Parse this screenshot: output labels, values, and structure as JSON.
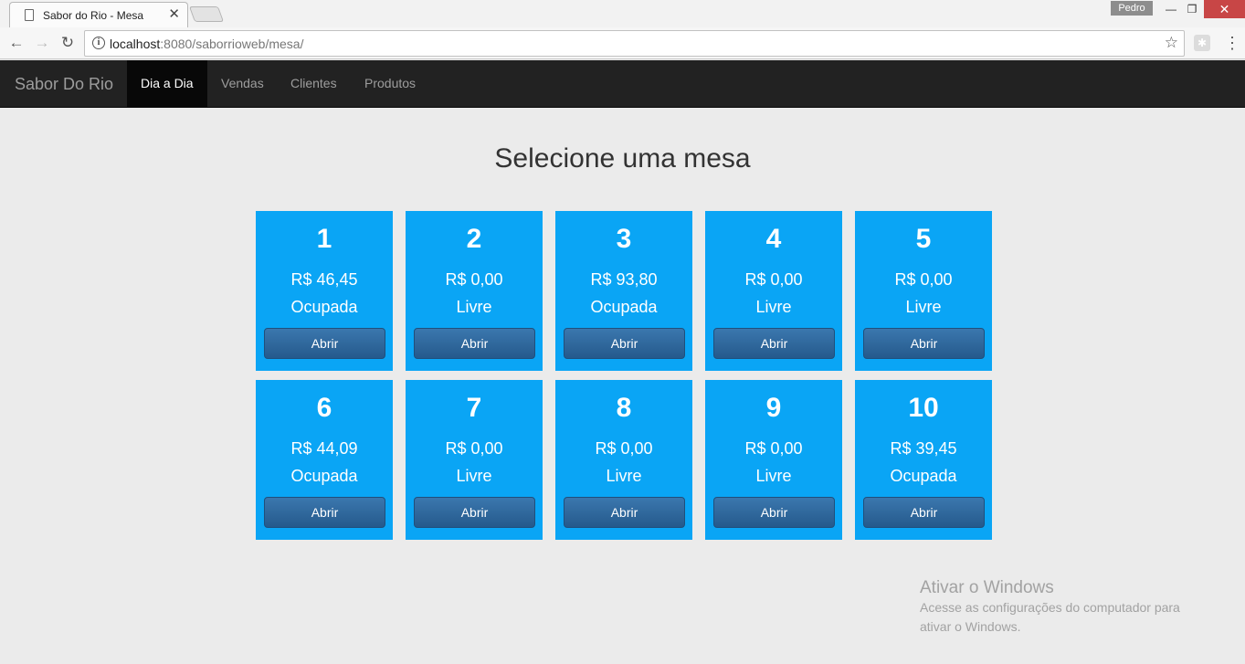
{
  "browser": {
    "tab_title": "Sabor do Rio - Mesa",
    "tab_close": "✕",
    "profile_name": "Pedro",
    "url_host": "localhost",
    "url_rest": ":8080/saborrioweb/mesa/"
  },
  "navbar": {
    "brand": "Sabor Do Rio",
    "items": [
      {
        "label": "Dia a Dia",
        "active": true
      },
      {
        "label": "Vendas",
        "active": false
      },
      {
        "label": "Clientes",
        "active": false
      },
      {
        "label": "Produtos",
        "active": false
      }
    ]
  },
  "page": {
    "title": "Selecione uma mesa"
  },
  "tables": [
    {
      "number": "1",
      "amount": "R$ 46,45",
      "status": "Ocupada",
      "button": "Abrir"
    },
    {
      "number": "2",
      "amount": "R$ 0,00",
      "status": "Livre",
      "button": "Abrir"
    },
    {
      "number": "3",
      "amount": "R$ 93,80",
      "status": "Ocupada",
      "button": "Abrir"
    },
    {
      "number": "4",
      "amount": "R$ 0,00",
      "status": "Livre",
      "button": "Abrir"
    },
    {
      "number": "5",
      "amount": "R$ 0,00",
      "status": "Livre",
      "button": "Abrir"
    },
    {
      "number": "6",
      "amount": "R$ 44,09",
      "status": "Ocupada",
      "button": "Abrir"
    },
    {
      "number": "7",
      "amount": "R$ 0,00",
      "status": "Livre",
      "button": "Abrir"
    },
    {
      "number": "8",
      "amount": "R$ 0,00",
      "status": "Livre",
      "button": "Abrir"
    },
    {
      "number": "9",
      "amount": "R$ 0,00",
      "status": "Livre",
      "button": "Abrir"
    },
    {
      "number": "10",
      "amount": "R$ 39,45",
      "status": "Ocupada",
      "button": "Abrir"
    }
  ],
  "watermark": {
    "title": "Ativar o Windows",
    "line1": "Acesse as configurações do computador para",
    "line2": "ativar o Windows."
  },
  "colors": {
    "card_bg": "#0aa5f5",
    "button_bg": "#2e6aa0",
    "navbar_bg": "#222222"
  },
  "icons": {
    "back": "back-arrow-icon",
    "forward": "forward-arrow-icon",
    "reload": "reload-icon",
    "info": "info-icon",
    "star": "star-icon",
    "menu": "kebab-menu-icon"
  }
}
